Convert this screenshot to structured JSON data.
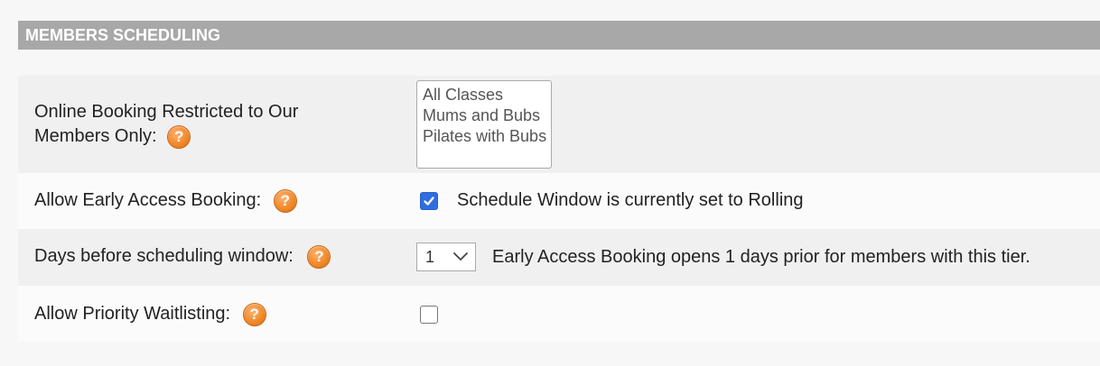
{
  "section": {
    "title": "MEMBERS SCHEDULING"
  },
  "rows": {
    "online_booking": {
      "label_line1": "Online Booking Restricted to Our",
      "label_line2": "Members Only:",
      "options": [
        "All Classes",
        "Mums and Bubs",
        "Pilates with Bubs"
      ]
    },
    "early_access": {
      "label": "Allow Early Access Booking:",
      "checked": true,
      "note": "Schedule Window is currently set to Rolling"
    },
    "days_before": {
      "label": "Days before scheduling window:",
      "selected_value": "1",
      "note": "Early Access Booking opens 1 days prior for members with this tier."
    },
    "priority_waitlist": {
      "label": "Allow Priority Waitlisting:",
      "checked": false
    }
  },
  "help_icon_glyph": "?",
  "colors": {
    "header_bg": "#a8a8a8",
    "checkbox_checked": "#2f6de0",
    "help_icon": "#f08a2a"
  }
}
